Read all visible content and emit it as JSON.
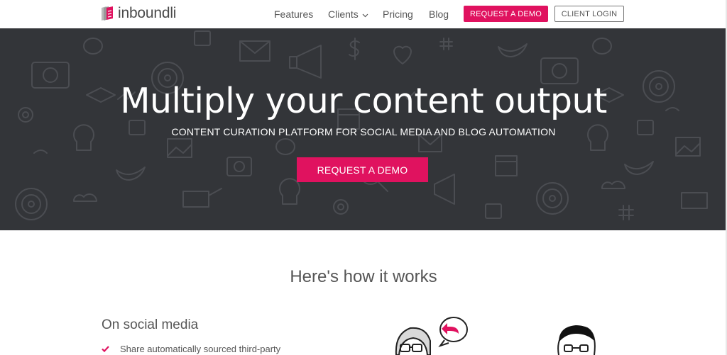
{
  "brand": {
    "name": "inboundli",
    "accent": "#e0125f"
  },
  "nav": {
    "features": "Features",
    "clients": "Clients",
    "pricing": "Pricing",
    "blog": "Blog",
    "request_demo": "REQUEST A DEMO",
    "client_login": "CLIENT LOGIN"
  },
  "hero": {
    "title": "Multiply your content output",
    "subtitle": "CONTENT CURATION PLATFORM FOR SOCIAL MEDIA AND BLOG AUTOMATION",
    "cta": "REQUEST A DEMO",
    "background": "#333539"
  },
  "how": {
    "title": "Here's how it works",
    "social_heading": "On social media",
    "bullets": [
      "Share automatically sourced third-party"
    ]
  }
}
